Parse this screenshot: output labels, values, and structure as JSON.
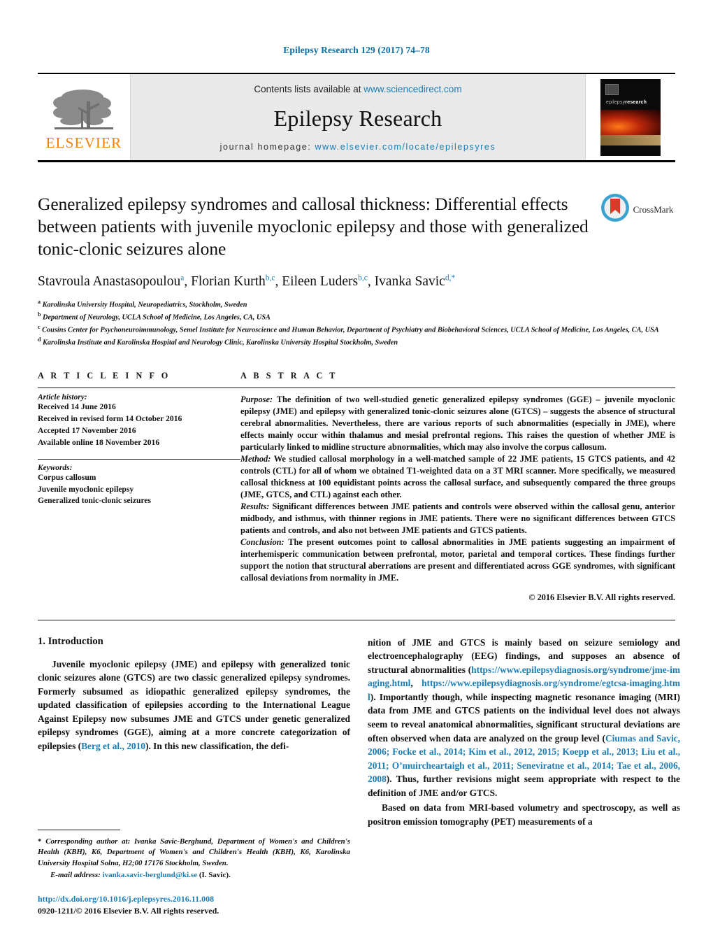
{
  "running_head": "Epilepsy Research 129 (2017) 74–78",
  "masthead": {
    "publisher_name": "ELSEVIER",
    "contents_prefix": "Contents lists available at ",
    "contents_link": "www.sciencedirect.com",
    "journal_name": "Epilepsy Research",
    "homepage_prefix": "journal homepage: ",
    "homepage_link": "www.elsevier.com/locate/epilepsyres",
    "cover_title_light": "epilepsy",
    "cover_title_bold": "research"
  },
  "article": {
    "title": "Generalized epilepsy syndromes and callosal thickness: Differential effects between patients with juvenile myoclonic epilepsy and those with generalized tonic-clonic seizures alone",
    "crossmark_label": "CrossMark",
    "authors_html": "Stavroula Anastasopoulou<sup>a</sup>, Florian Kurth<sup>b,c</sup>, Eileen Luders<sup>b,c</sup>, Ivanka Savic<sup>d,</sup><sup>*</sup>",
    "affiliations": [
      {
        "marker": "a",
        "text": "Karolinska University Hospital, Neuropediatrics, Stockholm, Sweden"
      },
      {
        "marker": "b",
        "text": "Department of Neurology, UCLA School of Medicine, Los Angeles, CA, USA"
      },
      {
        "marker": "c",
        "text": "Cousins Center for Psychoneuroimmunology, Semel Institute for Neuroscience and Human Behavior, Department of Psychiatry and Biobehavioral Sciences, UCLA School of Medicine, Los Angeles, CA, USA"
      },
      {
        "marker": "d",
        "text": "Karolinska Institute and Karolinska Hospital and Neurology Clinic, Karolinska University Hospital Stockholm, Sweden"
      }
    ]
  },
  "article_info": {
    "heading": "A R T I C L E   I N F O",
    "history_label": "Article history:",
    "history": [
      "Received 14 June 2016",
      "Received in revised form 14 October 2016",
      "Accepted 17 November 2016",
      "Available online 18 November 2016"
    ],
    "keywords_label": "Keywords:",
    "keywords": [
      "Corpus callosum",
      "Juvenile myoclonic epilepsy",
      "Generalized tonic-clonic seizures"
    ]
  },
  "abstract": {
    "heading": "A B S T R A C T",
    "purpose_label": "Purpose:",
    "purpose_text": " The definition of two well-studied genetic generalized epilepsy syndromes (GGE) – juvenile myoclonic epilepsy (JME) and epilepsy with generalized tonic-clonic seizures alone (GTCS) – suggests the absence of structural cerebral abnormalities. Nevertheless, there are various reports of such abnormalities (especially in JME), where effects mainly occur within thalamus and mesial prefrontal regions. This raises the question of whether JME is particularly linked to midline structure abnormalities, which may also involve the corpus callosum.",
    "method_label": "Method:",
    "method_text": " We studied callosal morphology in a well-matched sample of 22 JME patients, 15 GTCS patients, and 42 controls (CTL) for all of whom we obtained T1-weighted data on a 3T MRI scanner. More specifically, we measured callosal thickness at 100 equidistant points across the callosal surface, and subsequently compared the three groups (JME, GTCS, and CTL) against each other.",
    "results_label": "Results:",
    "results_text": " Significant differences between JME patients and controls were observed within the callosal genu, anterior midbody, and isthmus, with thinner regions in JME patients. There were no significant differences between GTCS patients and controls, and also not between JME patients and GTCS patients.",
    "conclusion_label": "Conclusion:",
    "conclusion_text": " The present outcomes point to callosal abnormalities in JME patients suggesting an impairment of interhemisperic communication between prefrontal, motor, parietal and temporal cortices. These findings further support the notion that structural aberrations are present and differentiated across GGE syndromes, with significant callosal deviations from normality in JME.",
    "copyright": "© 2016 Elsevier B.V. All rights reserved."
  },
  "introduction": {
    "heading": "1.  Introduction",
    "para1_a": "Juvenile myoclonic epilepsy (JME) and epilepsy with generalized tonic clonic seizures alone (GTCS) are two classic generalized epilepsy syndromes. Formerly subsumed as idiopathic generalized epilepsy syndromes, the updated classification of epilepsies according to the International League Against Epilepsy now subsumes JME and GTCS under genetic generalized epilepsy syndromes (GGE), aiming at a more concrete categorization of epilepsies (",
    "para1_ref1": "Berg et al., 2010",
    "para1_b": "). In this new classification, the definition of JME and GTCS is mainly based on seizure semiology and electroencephalography (EEG) findings, and supposes an absence of structural abnormalities (",
    "para1_link1": "https://www.epilepsydiagnosis.org/syndrome/jme-imaging.html",
    "para1_sep": ", ",
    "para1_link2": "https://www.epilepsydiagnosis.org/syndrome/egtcsa-imaging.html",
    "para1_c": "). Importantly though, while inspecting magnetic resonance imaging (MRI) data from JME and GTCS patients on the individual level does not always seem to reveal anatomical abnormalities, significant structural deviations are often observed when data are analyzed on the group level (",
    "para1_ref2": "Ciumas and Savic, 2006; Focke et al., 2014; Kim et al., 2012, 2015; Koepp et al., 2013; Liu et al., 2011; O’muircheartaigh et al., 2011; Seneviratne et al., 2014; Tae et al., 2006, 2008",
    "para1_d": "). Thus, further revisions might seem appropriate with respect to the definition of JME and/or GTCS.",
    "para2": "Based on data from MRI-based volumetry and spectroscopy, as well as positron emission tomography (PET) measurements of a"
  },
  "footnotes": {
    "corresponding_marker": "*",
    "corresponding_text": " Corresponding author at: Ivanka Savic-Berghund, Department of Women's and Children's Health (KBH), K6, Department of Women's and Children's Health (KBH), K6, Karolinska University Hospital Solna, H2;00 17176 Stockholm, Sweden.",
    "email_label": "E-mail address:",
    "email": "ivanka.savic-berglund@ki.se",
    "email_suffix": " (I. Savic).",
    "doi": "http://dx.doi.org/10.1016/j.eplepsyres.2016.11.008",
    "issn": "0920-1211/© 2016 Elsevier B.V. All rights reserved."
  },
  "colors": {
    "link_blue": "#1a7db5",
    "header_blue": "#0a6fa8",
    "elsevier_orange": "#f08000"
  }
}
